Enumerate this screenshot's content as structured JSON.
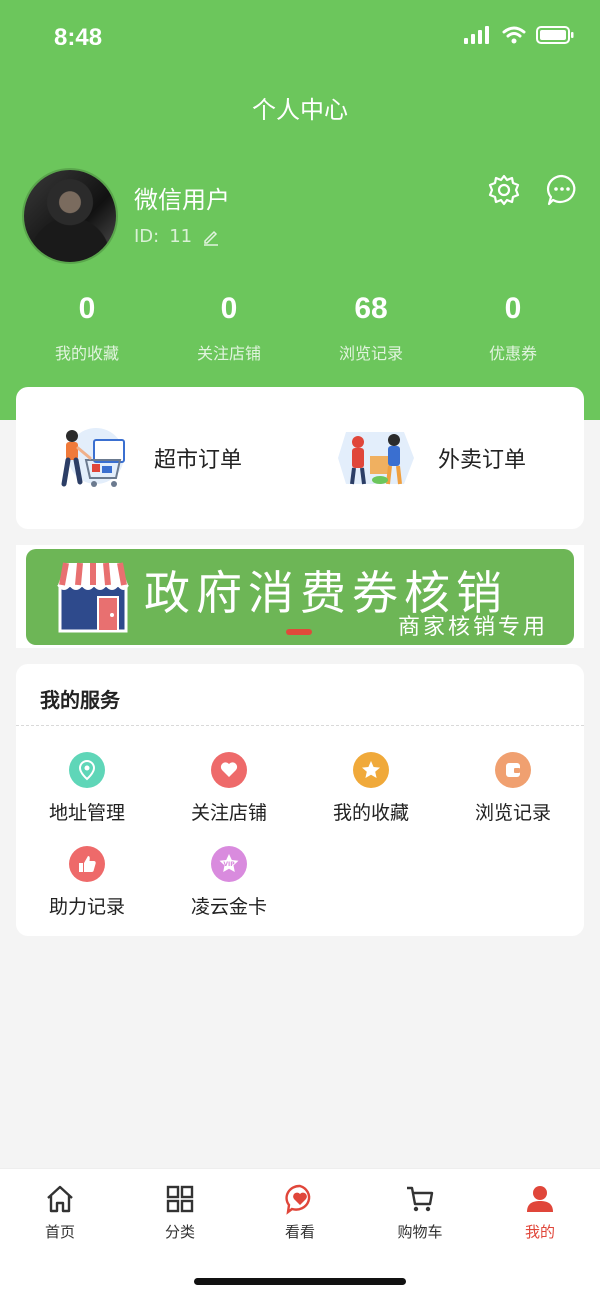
{
  "status_bar": {
    "time": "8:48"
  },
  "header": {
    "title": "个人中心",
    "username": "微信用户",
    "id_label": "ID:",
    "id_value": "11",
    "icons": {
      "settings": "gear-icon",
      "messages": "chat-bubble-icon",
      "edit": "pencil-icon"
    }
  },
  "stats": [
    {
      "value": "0",
      "label": "我的收藏"
    },
    {
      "value": "0",
      "label": "关注店铺"
    },
    {
      "value": "68",
      "label": "浏览记录"
    },
    {
      "value": "0",
      "label": "优惠券"
    }
  ],
  "orders": [
    {
      "label": "超市订单",
      "icon": "supermarket-cart-illustration"
    },
    {
      "label": "外卖订单",
      "icon": "delivery-illustration"
    }
  ],
  "banner": {
    "title": "政府消费券核销",
    "subtitle": "商家核销专用",
    "icon": "shop-icon"
  },
  "services": {
    "title": "我的服务",
    "items": [
      {
        "label": "地址管理",
        "icon": "location-pin-icon",
        "color": "#5fd6b8"
      },
      {
        "label": "关注店铺",
        "icon": "heart-icon",
        "color": "#ee6a6a"
      },
      {
        "label": "我的收藏",
        "icon": "star-icon",
        "color": "#f0a93a"
      },
      {
        "label": "浏览记录",
        "icon": "browse-history-icon",
        "color": "#f0a070"
      },
      {
        "label": "助力记录",
        "icon": "thumbs-up-icon",
        "color": "#ee6a6a"
      },
      {
        "label": "凌云金卡",
        "icon": "vip-badge-icon",
        "color": "#d98bde"
      }
    ]
  },
  "tabbar": {
    "items": [
      {
        "label": "首页",
        "icon": "home-icon"
      },
      {
        "label": "分类",
        "icon": "grid-icon"
      },
      {
        "label": "看看",
        "icon": "heart-chat-icon"
      },
      {
        "label": "购物车",
        "icon": "cart-icon"
      },
      {
        "label": "我的",
        "icon": "user-icon"
      }
    ],
    "active": "我的",
    "active_color": "#e0463a"
  },
  "colors": {
    "brand_green": "#6cc65c",
    "banner_green": "#6db656",
    "accent_red": "#e0463a"
  }
}
